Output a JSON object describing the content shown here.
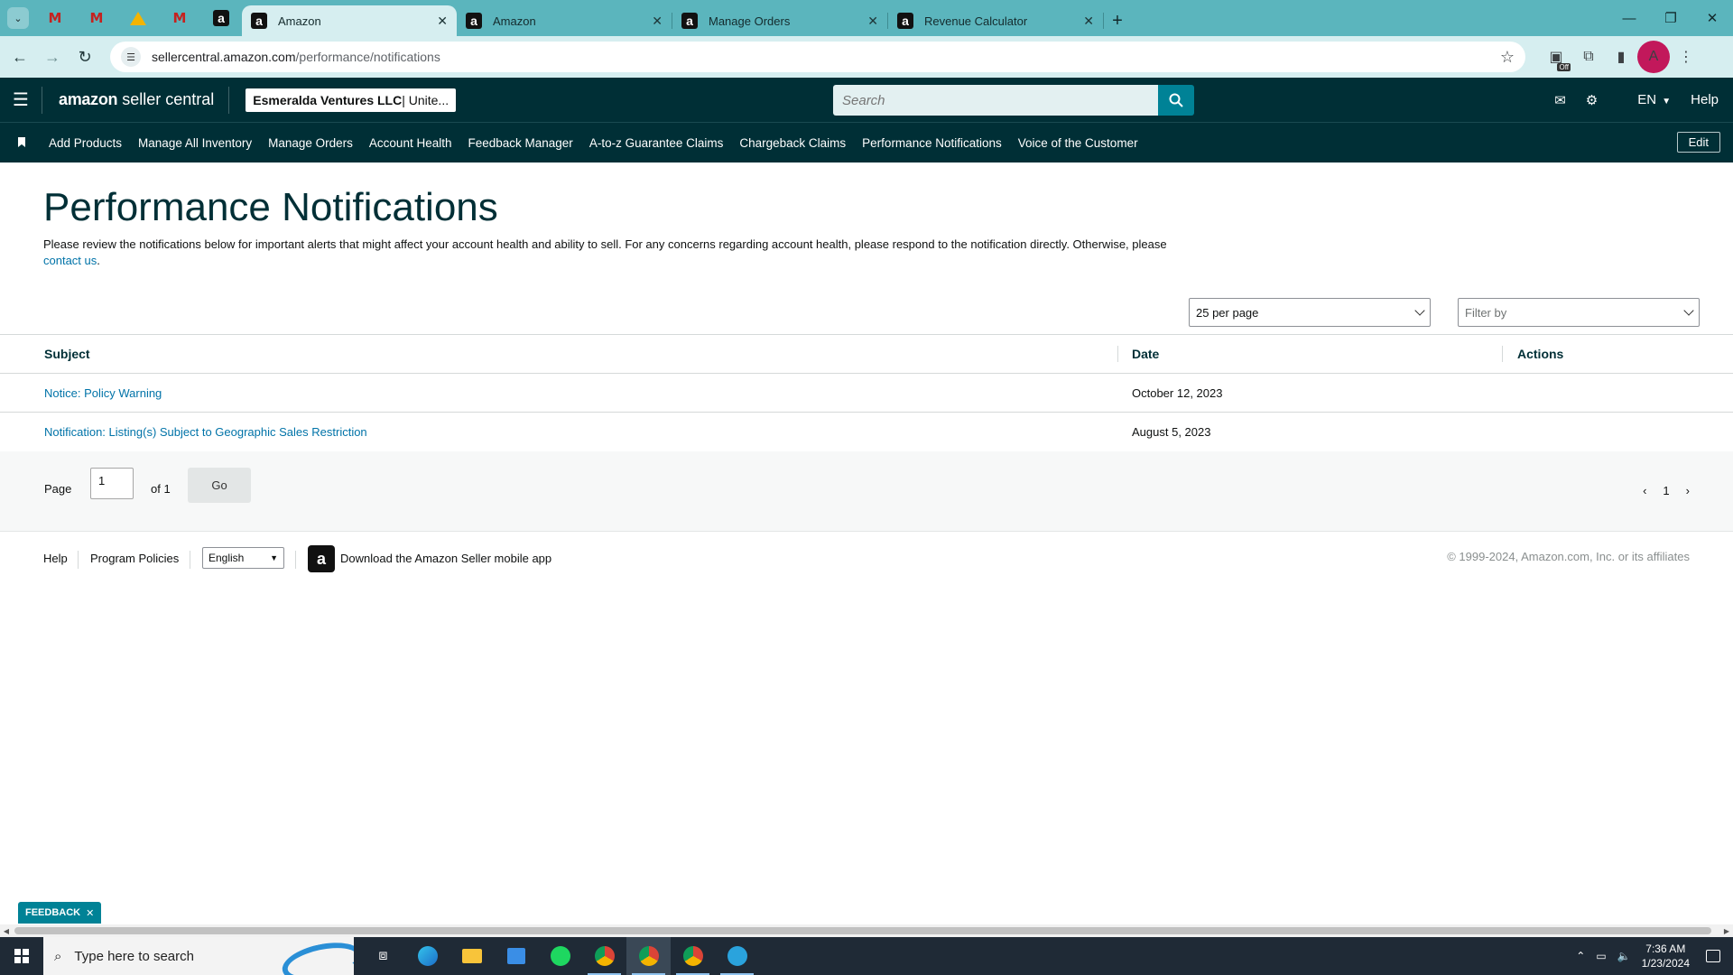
{
  "browser": {
    "tabs": [
      {
        "title": "Amazon",
        "active": true
      },
      {
        "title": "Amazon",
        "active": false
      },
      {
        "title": "Manage Orders",
        "active": false
      },
      {
        "title": "Revenue Calculator",
        "active": false
      }
    ],
    "url_host": "sellercentral.amazon.com",
    "url_path": "/performance/notifications",
    "profile_initial": "A",
    "extension_badge": "Off"
  },
  "header": {
    "logo_amazon": "amazon",
    "logo_sc": "seller central",
    "account_bold": "Esmeralda Ventures LLC",
    "account_rest": " | Unite...",
    "search_placeholder": "Search",
    "lang": "EN",
    "help": "Help"
  },
  "nav": {
    "items": [
      "Add Products",
      "Manage All Inventory",
      "Manage Orders",
      "Account Health",
      "Feedback Manager",
      "A-to-z Guarantee Claims",
      "Chargeback Claims",
      "Performance Notifications",
      "Voice of the Customer"
    ],
    "edit": "Edit"
  },
  "page": {
    "title": "Performance Notifications",
    "intro": "Please review the notifications below for important alerts that might affect your account health and ability to sell. For any concerns regarding account health, please respond to the notification directly. Otherwise, please ",
    "contact_link": "contact us",
    "per_page": "25 per page",
    "filter_placeholder": "Filter by"
  },
  "table": {
    "headers": {
      "subject": "Subject",
      "date": "Date",
      "actions": "Actions"
    },
    "rows": [
      {
        "subject": "Notice: Policy Warning",
        "date": "October 12, 2023"
      },
      {
        "subject": "Notification: Listing(s) Subject to Geographic Sales Restriction",
        "date": "August 5, 2023"
      }
    ]
  },
  "pager": {
    "label": "Page",
    "value": "1",
    "of": "of 1",
    "go": "Go",
    "current": "1"
  },
  "footer": {
    "help": "Help",
    "policies": "Program Policies",
    "language": "English",
    "app": "Download the Amazon Seller mobile app",
    "copyright": "© 1999-2024, Amazon.com, Inc. or its affiliates"
  },
  "feedback": "FEEDBACK",
  "taskbar": {
    "search_placeholder": "Type here to search",
    "time": "7:36 AM",
    "date": "1/23/2024"
  }
}
